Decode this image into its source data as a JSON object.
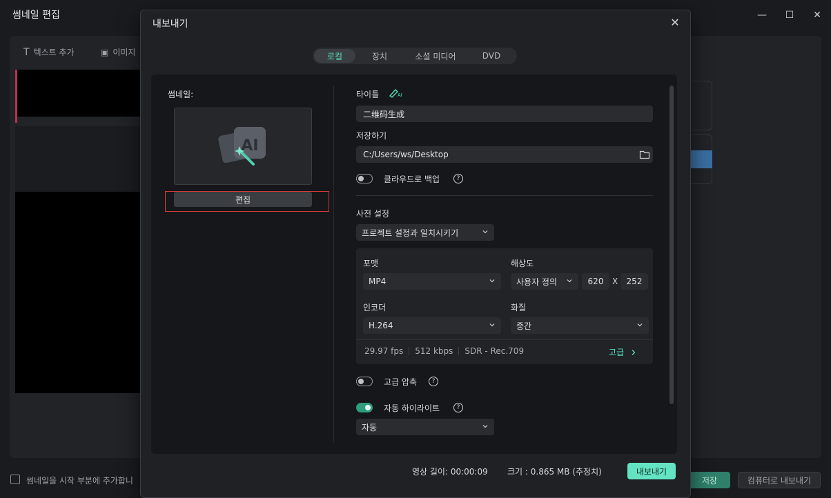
{
  "background": {
    "window_title": "썸네일 편집",
    "toolbar": {
      "add_text": "텍스트 추가",
      "add_image": "이미지"
    },
    "checkbox_label": "썸네일을 시작 부분에 추가합니",
    "save_label": "저장",
    "export_computer_label": "컴퓨터로 내보내기"
  },
  "dialog": {
    "title": "내보내기",
    "tabs": [
      {
        "label": "로컬",
        "active": true
      },
      {
        "label": "장치",
        "active": false
      },
      {
        "label": "소셜 미디어",
        "active": false
      },
      {
        "label": "DVD",
        "active": false
      }
    ],
    "thumbnail": {
      "label": "썸네일:",
      "edit_label": "편집",
      "ai_badge": "AI"
    },
    "title_label": "타이틀",
    "ai_title_badge": "AI",
    "title_value": "二维码生成",
    "save_to_label": "저장하기",
    "save_path": "C:/Users/ws/Desktop",
    "cloud_backup": {
      "label": "클라우드로 백업",
      "enabled": false
    },
    "preset": {
      "label": "사전 설정",
      "value": "프로젝트 설정과 일치시키기"
    },
    "format": {
      "label": "포맷",
      "value": "MP4"
    },
    "resolution": {
      "label": "해상도",
      "mode": "사용자 정의",
      "width": "620",
      "separator": "X",
      "height": "252"
    },
    "encoder": {
      "label": "인코더",
      "value": "H.264"
    },
    "quality": {
      "label": "화질",
      "value": "중간"
    },
    "meta": {
      "fps": "29.97 fps",
      "bitrate": "512 kbps",
      "color": "SDR - Rec.709",
      "advanced": "고급"
    },
    "advanced_compression": {
      "label": "고급 압축",
      "enabled": false
    },
    "auto_highlight": {
      "label": "자동 하이라이트",
      "enabled": true,
      "mode": "자동"
    },
    "footer": {
      "duration": "영상 길이: 00:00:09",
      "size": "크기 :  0.865 MB (추정치)",
      "export_label": "내보내기"
    }
  },
  "colors": {
    "accent": "#64e3c2",
    "highlight_outline": "#d33b3b"
  }
}
